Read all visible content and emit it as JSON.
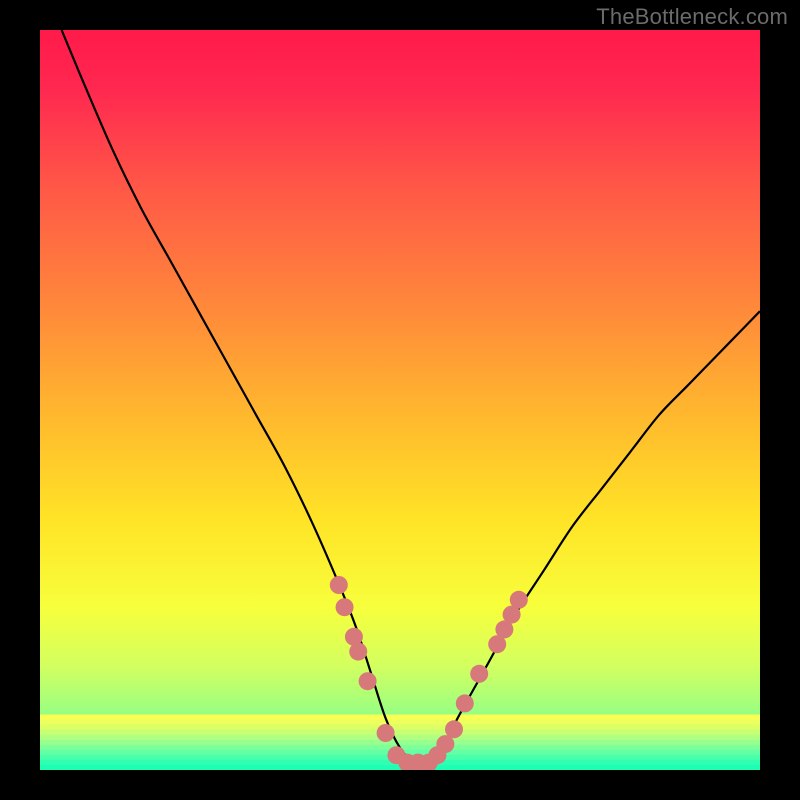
{
  "watermark": "TheBottleneck.com",
  "chart_data": {
    "type": "line",
    "title": "",
    "xlabel": "",
    "ylabel": "",
    "xlim": [
      0,
      100
    ],
    "ylim": [
      0,
      100
    ],
    "grid": false,
    "series": [
      {
        "name": "bottleneck-curve",
        "x": [
          3,
          6,
          10,
          14,
          18,
          22,
          26,
          30,
          34,
          38,
          42,
          44,
          46,
          48,
          50,
          52,
          54,
          56,
          58,
          62,
          66,
          70,
          74,
          78,
          82,
          86,
          90,
          94,
          98,
          100
        ],
        "y": [
          100,
          93,
          84,
          76,
          69,
          62,
          55,
          48,
          41,
          33,
          24,
          19,
          13,
          7,
          3,
          1,
          1,
          3,
          7,
          14,
          21,
          27,
          33,
          38,
          43,
          48,
          52,
          56,
          60,
          62
        ]
      }
    ],
    "markers": {
      "name": "dot-markers",
      "color": "#d7787a",
      "points": [
        {
          "x": 41.5,
          "y": 25
        },
        {
          "x": 42.3,
          "y": 22
        },
        {
          "x": 43.6,
          "y": 18
        },
        {
          "x": 44.2,
          "y": 16
        },
        {
          "x": 45.5,
          "y": 12
        },
        {
          "x": 48.0,
          "y": 5
        },
        {
          "x": 49.5,
          "y": 2
        },
        {
          "x": 51.0,
          "y": 1
        },
        {
          "x": 52.5,
          "y": 1
        },
        {
          "x": 54.0,
          "y": 1
        },
        {
          "x": 55.2,
          "y": 2
        },
        {
          "x": 56.3,
          "y": 3.5
        },
        {
          "x": 57.5,
          "y": 5.5
        },
        {
          "x": 59.0,
          "y": 9
        },
        {
          "x": 61.0,
          "y": 13
        },
        {
          "x": 63.5,
          "y": 17
        },
        {
          "x": 64.5,
          "y": 19
        },
        {
          "x": 65.5,
          "y": 21
        },
        {
          "x": 66.5,
          "y": 23
        }
      ]
    },
    "gradient_stops": [
      {
        "offset": 0.0,
        "color": "#ff1a4a"
      },
      {
        "offset": 0.08,
        "color": "#ff2850"
      },
      {
        "offset": 0.22,
        "color": "#ff5a46"
      },
      {
        "offset": 0.38,
        "color": "#ff8a3a"
      },
      {
        "offset": 0.52,
        "color": "#ffb82e"
      },
      {
        "offset": 0.66,
        "color": "#ffe326"
      },
      {
        "offset": 0.78,
        "color": "#f7ff3c"
      },
      {
        "offset": 0.86,
        "color": "#d2ff60"
      },
      {
        "offset": 0.92,
        "color": "#9cff80"
      },
      {
        "offset": 0.97,
        "color": "#4cffa0"
      },
      {
        "offset": 1.0,
        "color": "#1effb0"
      }
    ],
    "bottom_band": {
      "y_start": 92.5,
      "stripes": [
        "#faff54",
        "#edff5c",
        "#dcff66",
        "#c8ff72",
        "#b1ff80",
        "#98ff8e",
        "#7dff9a",
        "#62ffa4",
        "#48ffac",
        "#30ffb2",
        "#1effb6"
      ]
    }
  }
}
